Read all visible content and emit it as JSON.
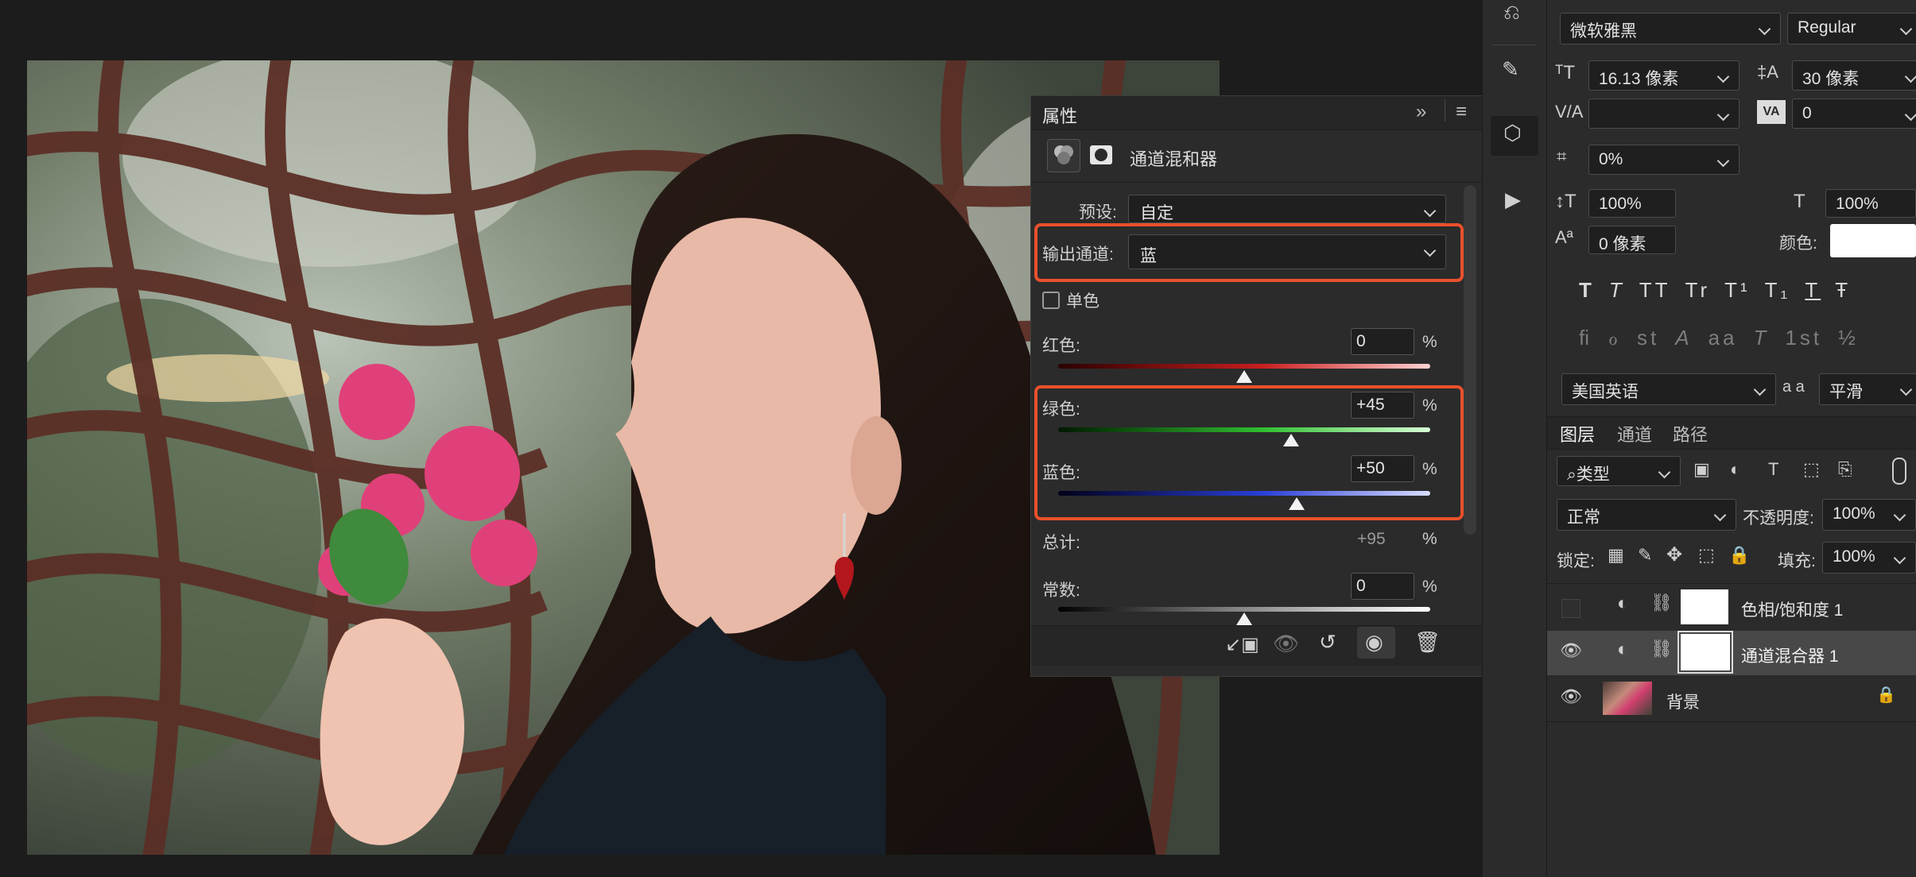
{
  "properties": {
    "tab_label": "属性",
    "adjustment_title": "通道混和器",
    "preset_label": "预设:",
    "preset_value": "自定",
    "output_channel_label": "输出通道:",
    "output_channel_value": "蓝",
    "monochrome_label": "单色",
    "sliders": [
      {
        "label": "红色:",
        "value": "0",
        "unit": "%",
        "level": 0.5,
        "color": "#c71f1f"
      },
      {
        "label": "绿色:",
        "value": "+45",
        "unit": "%",
        "level": 0.625,
        "color": "#2fbf2f"
      },
      {
        "label": "蓝色:",
        "value": "+50",
        "unit": "%",
        "level": 0.64,
        "color": "#2a3fd6"
      }
    ],
    "total_label": "总计:",
    "total_value": "+95",
    "total_unit": "%",
    "constant_label": "常数:",
    "constant_value": "0",
    "constant_unit": "%",
    "constant_level": 0.5
  },
  "character": {
    "font_family": "微软雅黑",
    "font_style": "Regular",
    "font_size": "16.13 像素",
    "leading": "30 像素",
    "kerning_value": "",
    "tracking_value": "0",
    "tsume_value": "0%",
    "vertical_scale": "100%",
    "horizontal_scale": "100%",
    "baseline_shift": "0 像素",
    "color_label": "颜色:",
    "language": "美国英语",
    "antialias_icon_text": "a a",
    "antialias_value": "平滑",
    "text_style_buttons": [
      "T",
      "T",
      "TT",
      "Tr",
      "T¹",
      "T₁",
      "T",
      "Ŧ"
    ],
    "opentype_buttons": [
      "ﬁ",
      "ℴ",
      "st",
      "A",
      "aa",
      "T",
      "1st",
      "½"
    ]
  },
  "layers": {
    "tabs": [
      "图层",
      "通道",
      "路径"
    ],
    "filter_label": "类型",
    "blend_mode": "正常",
    "opacity_label": "不透明度:",
    "opacity_value": "100%",
    "lock_label": "锁定:",
    "fill_label": "填充:",
    "fill_value": "100%",
    "items": [
      {
        "name": "色相/饱和度 1",
        "visible": false
      },
      {
        "name": "通道混合器 1",
        "visible": true
      },
      {
        "name": "背景",
        "visible": true
      }
    ]
  },
  "colors": {
    "accent_highlight": "#e9502c",
    "panel_bg": "#2b2b2b"
  }
}
